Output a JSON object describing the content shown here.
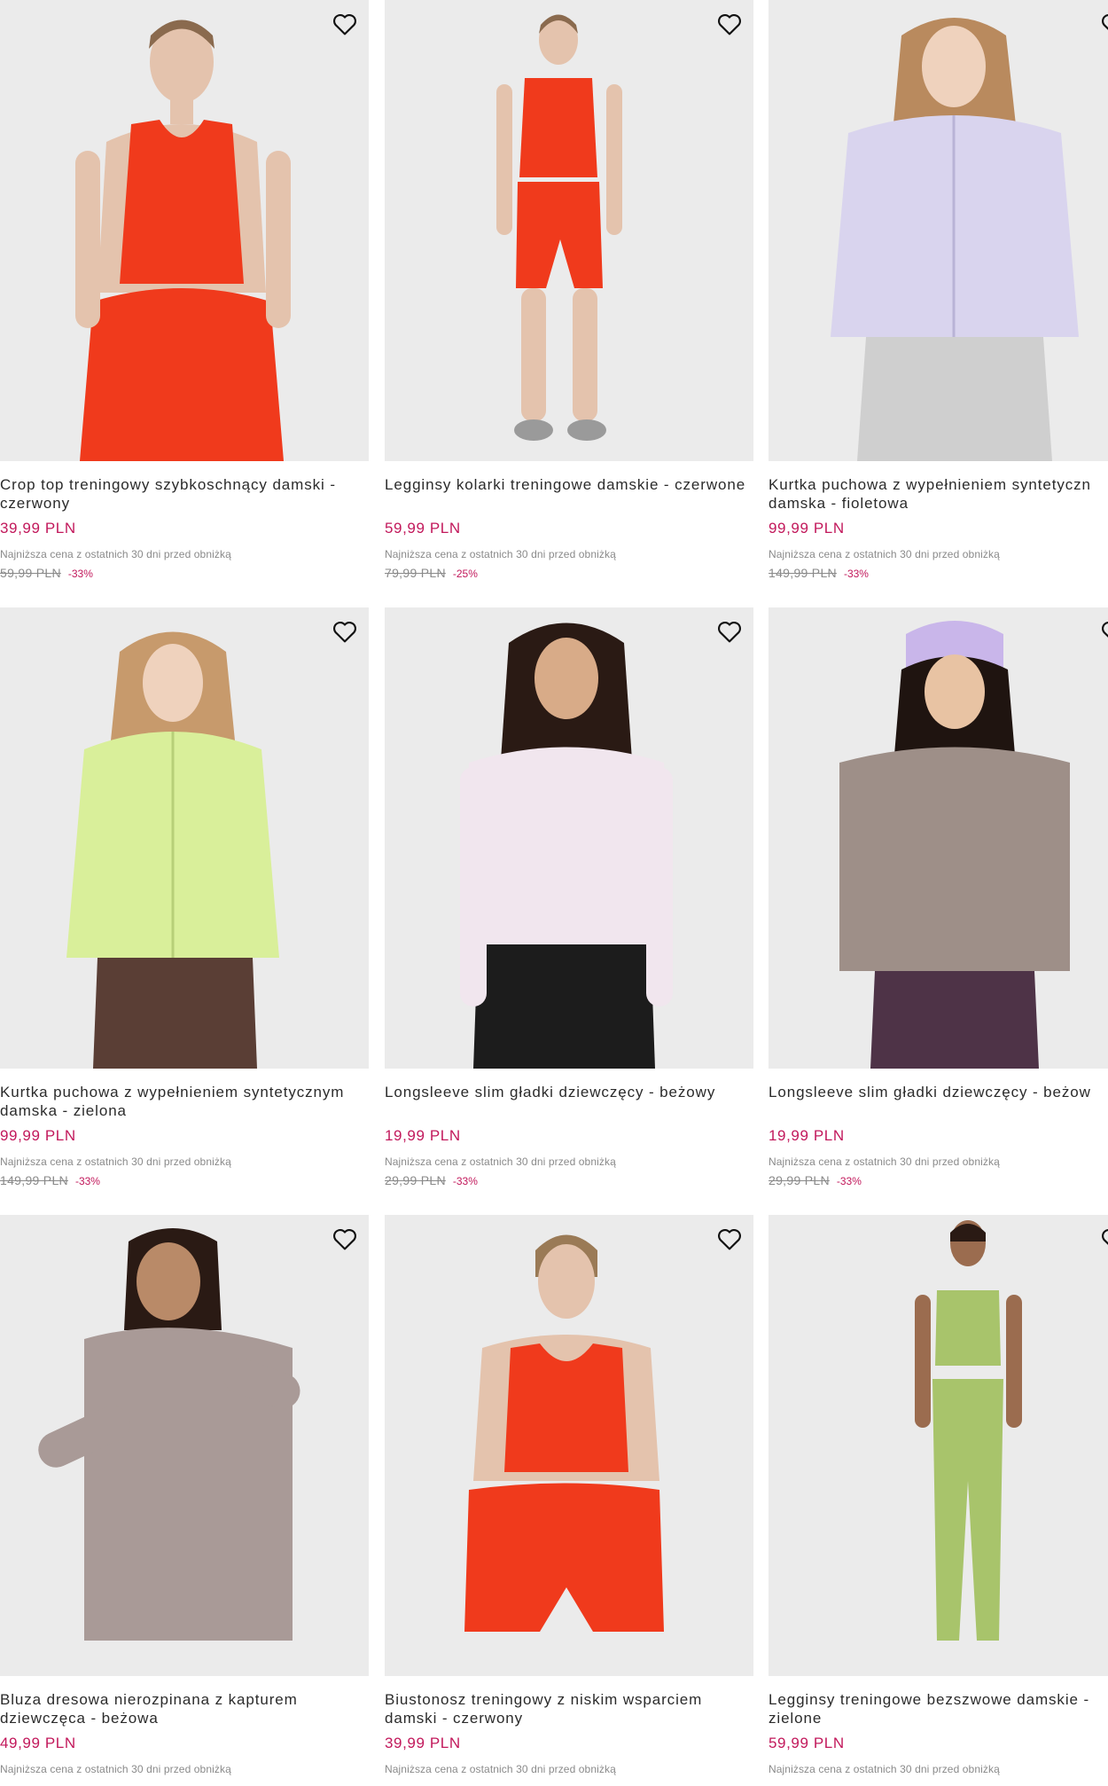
{
  "colors": {
    "price": "#c2185b",
    "image_bg": "#ebebeb",
    "text": "#2b2b2b",
    "muted": "#8a8a8a"
  },
  "lowest_price_note": "Najniższa cena z ostatnich 30 dni przed obniżką",
  "products": [
    {
      "title": "Crop top treningowy szybkoschnący damski - czerwony",
      "price": "39,99 PLN",
      "old_price": "59,99 PLN",
      "discount": "-33%",
      "icon": "heart-outline-icon",
      "garment_colors": [
        "#f03a1c",
        "#f03a1c"
      ]
    },
    {
      "title": "Legginsy kolarki treningowe damskie - czerwone",
      "price": "59,99 PLN",
      "old_price": "79,99 PLN",
      "discount": "-25%",
      "icon": "heart-outline-icon",
      "garment_colors": [
        "#f03a1c",
        "#f03a1c"
      ]
    },
    {
      "title": "Kurtka puchowa z wypełnieniem syntetyczn damska - fioletowa",
      "price": "99,99 PLN",
      "old_price": "149,99 PLN",
      "discount": "-33%",
      "icon": "heart-outline-icon",
      "garment_colors": [
        "#d9d4ee",
        "#cfcfcf"
      ]
    },
    {
      "title": "Kurtka puchowa z wypełnieniem syntetycznym damska - zielona",
      "price": "99,99 PLN",
      "old_price": "149,99 PLN",
      "discount": "-33%",
      "icon": "heart-outline-icon",
      "garment_colors": [
        "#d9ef9a",
        "#5a3e35"
      ]
    },
    {
      "title": "Longsleeve slim gładki dziewczęcy - beżowy",
      "price": "19,99 PLN",
      "old_price": "29,99 PLN",
      "discount": "-33%",
      "icon": "heart-outline-icon",
      "garment_colors": [
        "#f1e6ee",
        "#1c1c1c"
      ]
    },
    {
      "title": "Longsleeve slim gładki dziewczęcy - beżow",
      "price": "19,99 PLN",
      "old_price": "29,99 PLN",
      "discount": "-33%",
      "icon": "heart-outline-icon",
      "garment_colors": [
        "#9e8f88",
        "#4e3347"
      ]
    },
    {
      "title": "Bluza dresowa nierozpinana z kapturem dziewczęca - beżowa",
      "price": "49,99 PLN",
      "old_price": "",
      "discount": "",
      "icon": "heart-outline-icon",
      "garment_colors": [
        "#a99a97",
        "#a99a97"
      ]
    },
    {
      "title": "Biustonosz treningowy z niskim wsparciem damski - czerwony",
      "price": "39,99 PLN",
      "old_price": "",
      "discount": "",
      "icon": "heart-outline-icon",
      "garment_colors": [
        "#f03a1c",
        "#f03a1c"
      ]
    },
    {
      "title": "Legginsy treningowe bezszwowe damskie - zielone",
      "price": "59,99 PLN",
      "old_price": "",
      "discount": "",
      "icon": "heart-outline-icon",
      "garment_colors": [
        "#a8c46b",
        "#a8c46b"
      ]
    }
  ]
}
